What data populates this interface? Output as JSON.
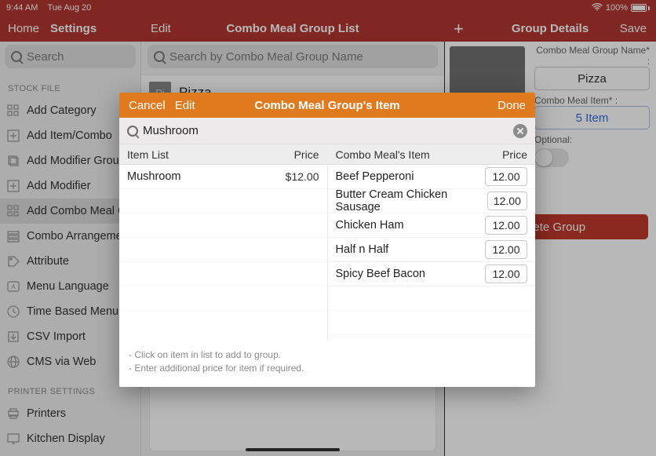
{
  "status": {
    "time": "9:44 AM",
    "date": "Tue Aug 20",
    "battery": "100%"
  },
  "header": {
    "left": {
      "home": "Home",
      "settings": "Settings"
    },
    "mid": {
      "edit": "Edit",
      "title": "Combo Meal Group List"
    },
    "right": {
      "plus": "+",
      "title": "Group Details",
      "save": "Save"
    }
  },
  "search": {
    "left_placeholder": "Search",
    "mid_placeholder": "Search by Combo Meal Group Name"
  },
  "sidebar": {
    "section1": "STOCK FILE",
    "items": [
      "Add Category",
      "Add Item/Combo",
      "Add Modifier Group",
      "Add Modifier",
      "Add Combo Meal Group",
      "Combo Arrangement",
      "Attribute",
      "Menu Language",
      "Time Based Menu",
      "CSV Import",
      "CMS via Web"
    ],
    "section2": "PRINTER SETTINGS",
    "items2": [
      "Printers",
      "Kitchen Display"
    ]
  },
  "group": {
    "badge": "Pi",
    "name": "Pizza"
  },
  "details": {
    "name_label": "Combo Meal Group Name* :",
    "name_value": "Pizza",
    "item_label": "Combo Meal Item* :",
    "item_value": "5 Item",
    "optional_label": "Optional:",
    "delete": "Delete Group"
  },
  "modal": {
    "cancel": "Cancel",
    "edit": "Edit",
    "title": "Combo Meal Group's Item",
    "done": "Done",
    "search_value": "Mushroom",
    "left": {
      "header": "Item List",
      "price_header": "Price",
      "rows": [
        {
          "name": "Mushroom",
          "price": "$12.00"
        }
      ]
    },
    "right": {
      "header": "Combo Meal's Item",
      "price_header": "Price",
      "rows": [
        {
          "name": "Beef Pepperoni",
          "price": "12.00"
        },
        {
          "name": "Butter Cream Chicken Sausage",
          "price": "12.00"
        },
        {
          "name": "Chicken Ham",
          "price": "12.00"
        },
        {
          "name": "Half n Half",
          "price": "12.00"
        },
        {
          "name": "Spicy Beef Bacon",
          "price": "12.00"
        }
      ]
    },
    "footer1": "- Click on item in list to add to group.",
    "footer2": "- Enter additional price for item if required."
  }
}
